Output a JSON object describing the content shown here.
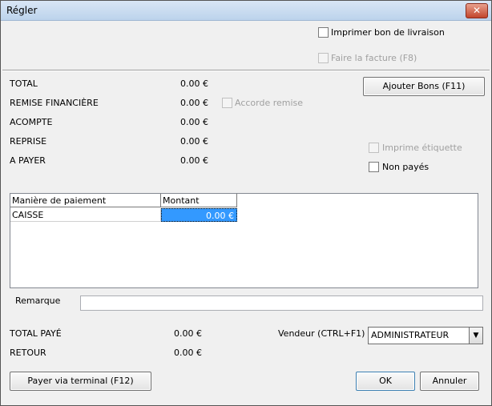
{
  "window": {
    "title": "Régler",
    "close_glyph": "✕"
  },
  "options": {
    "print_delivery": "Imprimer bon de livraison",
    "make_invoice": "Faire la facture (F8)",
    "accord_remise": "Accorde remise",
    "print_label": "Imprime étiquette",
    "unpaid": "Non payés"
  },
  "summary": [
    {
      "label": "TOTAL",
      "value": "0.00 €"
    },
    {
      "label": "REMISE FINANCIÈRE",
      "value": "0.00 €"
    },
    {
      "label": "ACOMPTE",
      "value": "0.00 €"
    },
    {
      "label": "REPRISE",
      "value": "0.00 €"
    },
    {
      "label": "A PAYER",
      "value": "0.00 €"
    }
  ],
  "buttons": {
    "add_vouchers": "Ajouter Bons (F11)",
    "pay_terminal": "Payer via terminal (F12)",
    "ok": "OK",
    "cancel": "Annuler"
  },
  "payment_grid": {
    "columns": [
      "Manière de paiement",
      "Montant"
    ],
    "rows": [
      {
        "method": "CAISSE",
        "amount": "0.00 €"
      }
    ]
  },
  "remark": {
    "label": "Remarque",
    "value": ""
  },
  "totals": [
    {
      "label": "TOTAL PAYÉ",
      "value": "0.00 €"
    },
    {
      "label": "RETOUR",
      "value": "0.00 €"
    }
  ],
  "seller": {
    "label": "Vendeur (CTRL+F1)",
    "value": "ADMINISTRATEUR"
  }
}
